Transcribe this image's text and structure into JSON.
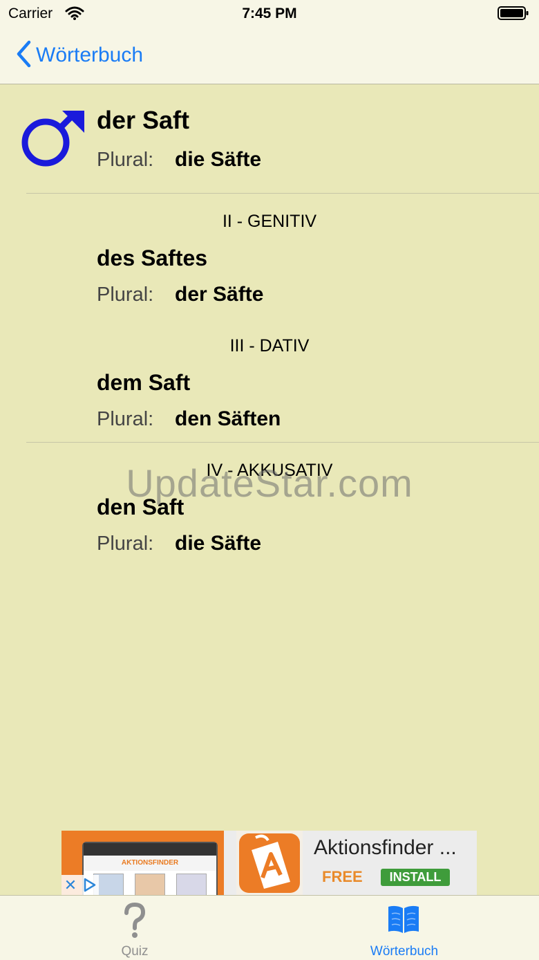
{
  "status_bar": {
    "carrier": "Carrier",
    "time": "7:45 PM"
  },
  "nav": {
    "back_label": "Wörterbuch"
  },
  "entry": {
    "gender_icon": "male-symbol-icon",
    "nominative": {
      "word": "der Saft",
      "plural_label": "Plural:",
      "plural": "die Säfte"
    },
    "cases": [
      {
        "heading": "II - GENITIV",
        "word": "des Saftes",
        "plural_label": "Plural:",
        "plural": "der Säfte"
      },
      {
        "heading": "III - DATIV",
        "word": "dem Saft",
        "plural_label": "Plural:",
        "plural": "den Säften"
      },
      {
        "heading": "IV - AKKUSATIV",
        "word": "den Saft",
        "plural_label": "Plural:",
        "plural": "die Säfte"
      }
    ]
  },
  "watermark": "UpdateStar.com",
  "ad": {
    "title": "Aktionsfinder ...",
    "price": "FREE",
    "install_label": "INSTALL",
    "phone_header": "AKTIONSFINDER"
  },
  "tabs": [
    {
      "label": "Quiz",
      "icon": "question-mark-icon",
      "active": false
    },
    {
      "label": "Wörterbuch",
      "icon": "book-icon",
      "active": true
    }
  ],
  "colors": {
    "background": "#e9e8b8",
    "accent": "#1a7cf5",
    "male_symbol": "#1a1adb",
    "inactive_tab": "#8f8f8f"
  }
}
